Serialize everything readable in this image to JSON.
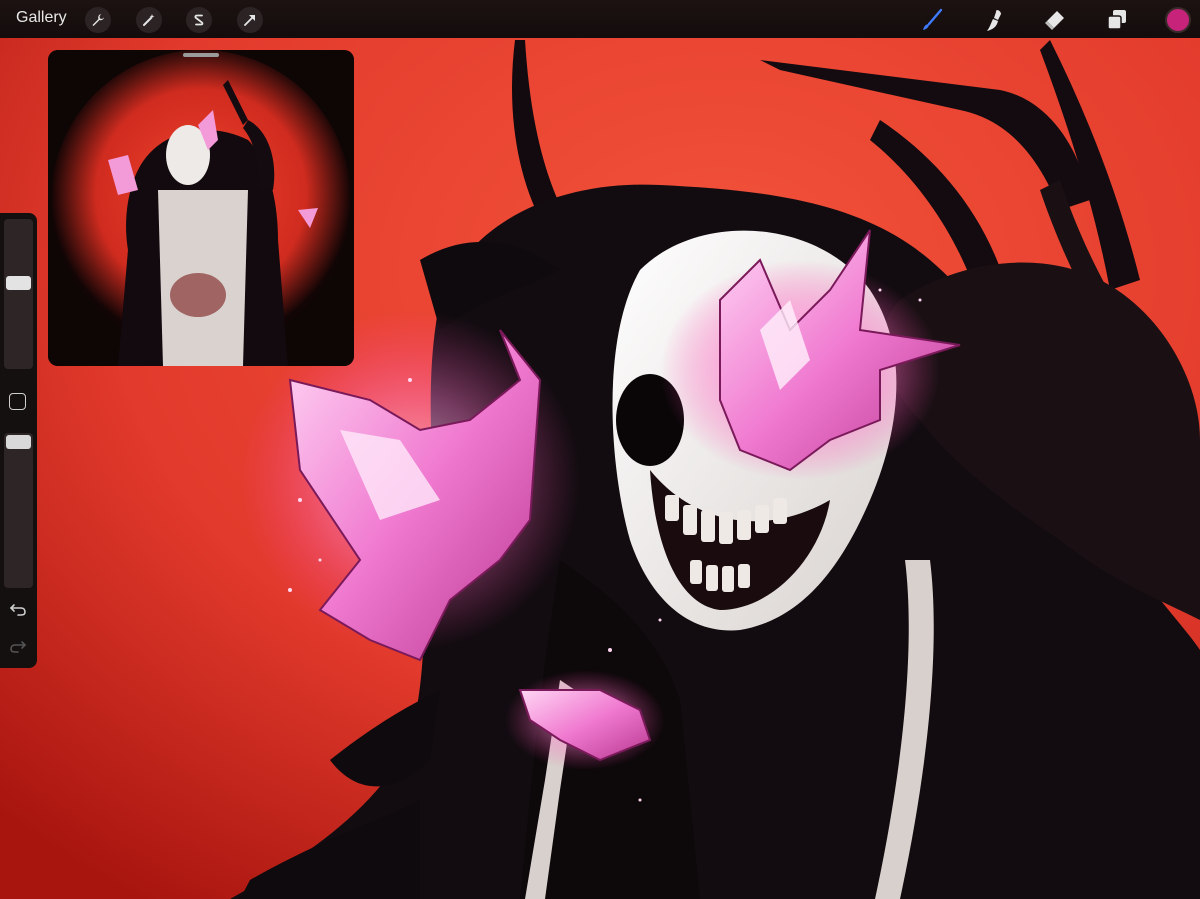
{
  "app": {
    "gallery_label": "Gallery"
  },
  "toolbar": {
    "left_icons": [
      "wrench-icon",
      "magic-wand-icon",
      "selection-s-icon",
      "transform-arrow-icon"
    ],
    "right_icons": [
      "brush-icon",
      "smudge-icon",
      "eraser-icon",
      "layers-icon"
    ],
    "active_tool": "brush",
    "active_tool_color": "#3f7bff",
    "current_color": "#c7237a"
  },
  "canvas": {
    "background_color": "#e23a2c"
  },
  "sidebar": {
    "brush_size": 0.58,
    "brush_opacity": 1.0,
    "icons": [
      "undo-icon",
      "redo-icon"
    ]
  }
}
